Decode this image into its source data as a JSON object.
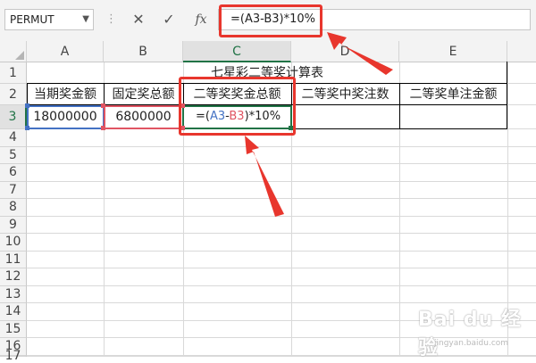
{
  "formula_bar": {
    "name_box": "PERMUT",
    "cancel_icon": "✕",
    "enter_icon": "✓",
    "fx_label": "fx",
    "formula": "=(A3-B3)*10%"
  },
  "columns": [
    "A",
    "B",
    "C",
    "D",
    "E"
  ],
  "active_column": "C",
  "rows": [
    "1",
    "2",
    "3",
    "4",
    "5",
    "6",
    "7",
    "8",
    "9",
    "10",
    "11",
    "12",
    "13",
    "14",
    "15",
    "16",
    "17"
  ],
  "active_row": "3",
  "sheet": {
    "title": "七星彩二等奖计算表",
    "headers": [
      "当期奖金额",
      "固定奖总额",
      "二等奖奖金总额",
      "二等奖中奖注数",
      "二等奖单注金额"
    ],
    "row3": {
      "a": "18000000",
      "b": "6800000",
      "c_eq": "=(",
      "c_a3": "A3",
      "c_minus": "-",
      "c_b3": "B3",
      "c_tail": ")*10%",
      "d": "",
      "e": ""
    }
  },
  "colors": {
    "accent_green": "#217346",
    "ref_blue": "#4472c4",
    "ref_red": "#e05563",
    "annotation_red": "#e8362d"
  },
  "watermark": {
    "brand": "Bai du 经验",
    "url": "jingyan.baidu.com"
  }
}
